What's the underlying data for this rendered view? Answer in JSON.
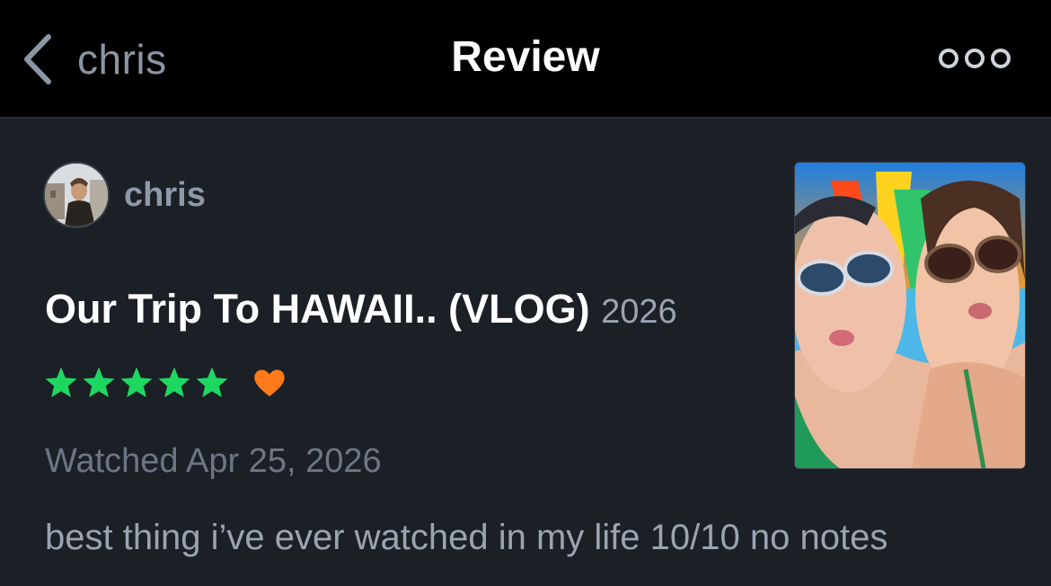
{
  "header": {
    "back_label": "chris",
    "title": "Review",
    "more_icon": "more-dots-icon"
  },
  "review": {
    "author": "chris",
    "film_title": "Our Trip To HAWAII.. (VLOG)",
    "film_year": "2026",
    "rating_stars": 5,
    "rating_max": 5,
    "liked": true,
    "watched_text": "Watched Apr 25, 2026",
    "body": "best thing i’ve ever watched in my life 10/10 no notes"
  },
  "colors": {
    "star": "#1ed760",
    "heart": "#ff7a1a",
    "background": "#1b1f26",
    "header_bg": "#000000"
  }
}
